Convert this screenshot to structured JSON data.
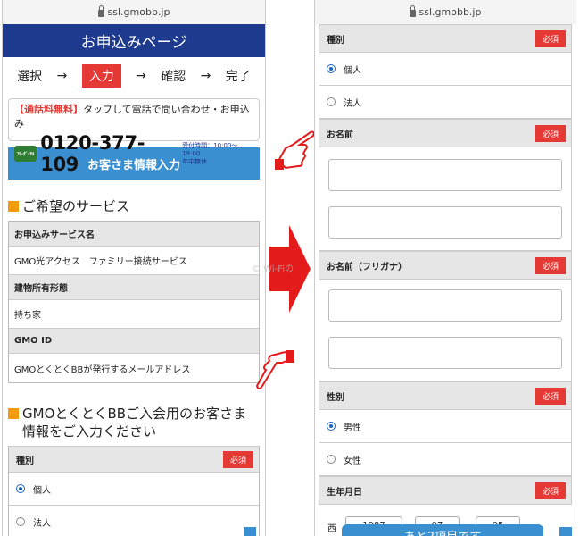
{
  "url": "ssl.gmobb.jp",
  "left": {
    "title": "お申込みページ",
    "steps": [
      "選択",
      "入力",
      "確認",
      "完了"
    ],
    "step_arrow": "→",
    "call": {
      "free_label": "【通話料無料】",
      "prompt": "タップして電話で問い合わせ・お申込み",
      "freedial": "ﾌﾘｰﾀﾞｲﾔﾙ",
      "number": "0120-377-109",
      "hours1": "受付時間：10:00～19:00",
      "hours2": "年中無休"
    },
    "customer_button": "お客さま情報入力",
    "service_heading": "ご希望のサービス",
    "service_table": [
      {
        "label": "お申込みサービス名",
        "value": "GMO光アクセス　ファミリー接続サービス"
      },
      {
        "label": "建物所有形態",
        "value": "持ち家"
      },
      {
        "label": "GMO ID",
        "value": "GMOとくとくBBが発行するメールアドレス"
      }
    ],
    "member_heading": "GMOとくとくBBご入会用のお客さま情報をご入力ください",
    "type_label": "種別",
    "required": "必須",
    "options": [
      "個人",
      "法人"
    ]
  },
  "right": {
    "type_label": "種別",
    "type_options": [
      "個人",
      "法人"
    ],
    "name_label": "お名前",
    "kana_label": "お名前（フリガナ）",
    "gender_label": "性別",
    "gender_options": [
      "男性",
      "女性"
    ],
    "birth_label": "生年月日",
    "required": "必須",
    "birth_prefix": "西",
    "birth_year": "1987",
    "birth_month": "07",
    "birth_day": "05",
    "bottom_text": "あと2項目です"
  },
  "watermark": "© Wi-Fiの",
  "colors": {
    "navy": "#1e3a8f",
    "red": "#e53935",
    "blue": "#3a8fd0",
    "orange": "#f39c12"
  }
}
